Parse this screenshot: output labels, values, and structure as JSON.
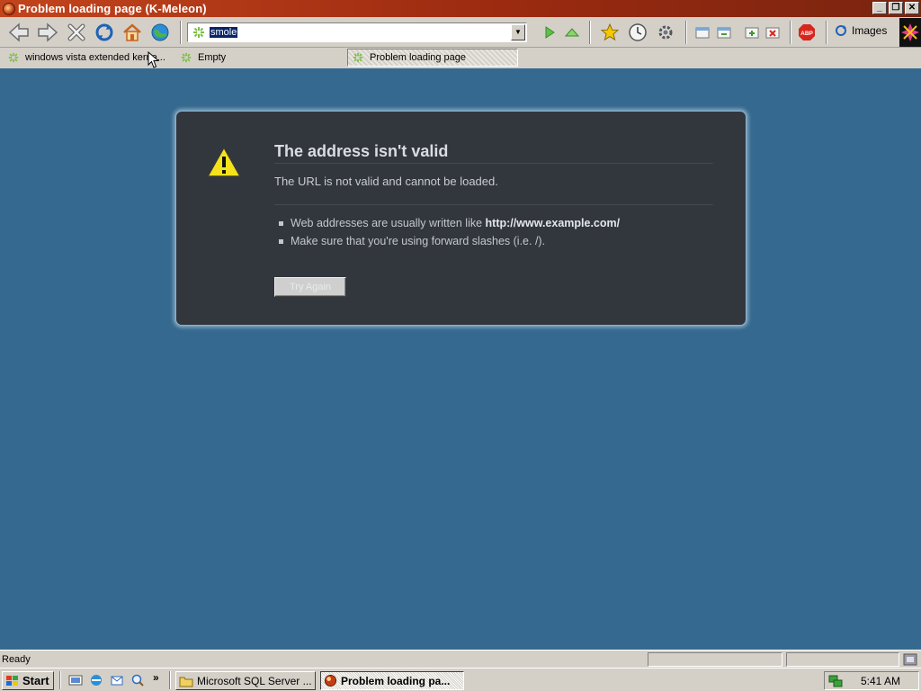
{
  "window": {
    "title": "Problem loading page (K-Meleon)",
    "controls": [
      "minimize",
      "restore",
      "close"
    ]
  },
  "toolbar": {
    "buttons": [
      "back-icon",
      "forward-icon",
      "stop-icon",
      "reload-icon",
      "home-icon",
      "globe-icon"
    ],
    "url_value": "smole",
    "right_buttons": [
      "go-icon",
      "up-icon",
      "bookmark-star-icon",
      "history-clock-icon",
      "settings-gear-icon",
      "window-icons",
      "adblock-icon"
    ],
    "images_label": "Images",
    "adblock_label": "ABP"
  },
  "tabs": [
    {
      "label": "windows vista extended kerne...",
      "active": false
    },
    {
      "label": "Empty",
      "active": false
    },
    {
      "label": "Problem loading page",
      "active": true
    }
  ],
  "error": {
    "title": "The address isn't valid",
    "message": "The URL is not valid and cannot be loaded.",
    "bullet1_prefix": "Web addresses are usually written like ",
    "bullet1_strong": "http://www.example.com/",
    "bullet2": "Make sure that you're using forward slashes (i.e. /).",
    "button_label": "Try Again"
  },
  "status": {
    "text": "Ready"
  },
  "taskbar": {
    "start_label": "Start",
    "overflow": "»",
    "tasks": [
      {
        "label": "Microsoft SQL Server ...",
        "active": false
      },
      {
        "label": "Problem loading pa...",
        "active": true
      }
    ],
    "clock": "5:41 AM"
  },
  "colors": {
    "content_bg": "#35698f",
    "error_bg": "#32363d",
    "titlebar": "#b5381a"
  }
}
